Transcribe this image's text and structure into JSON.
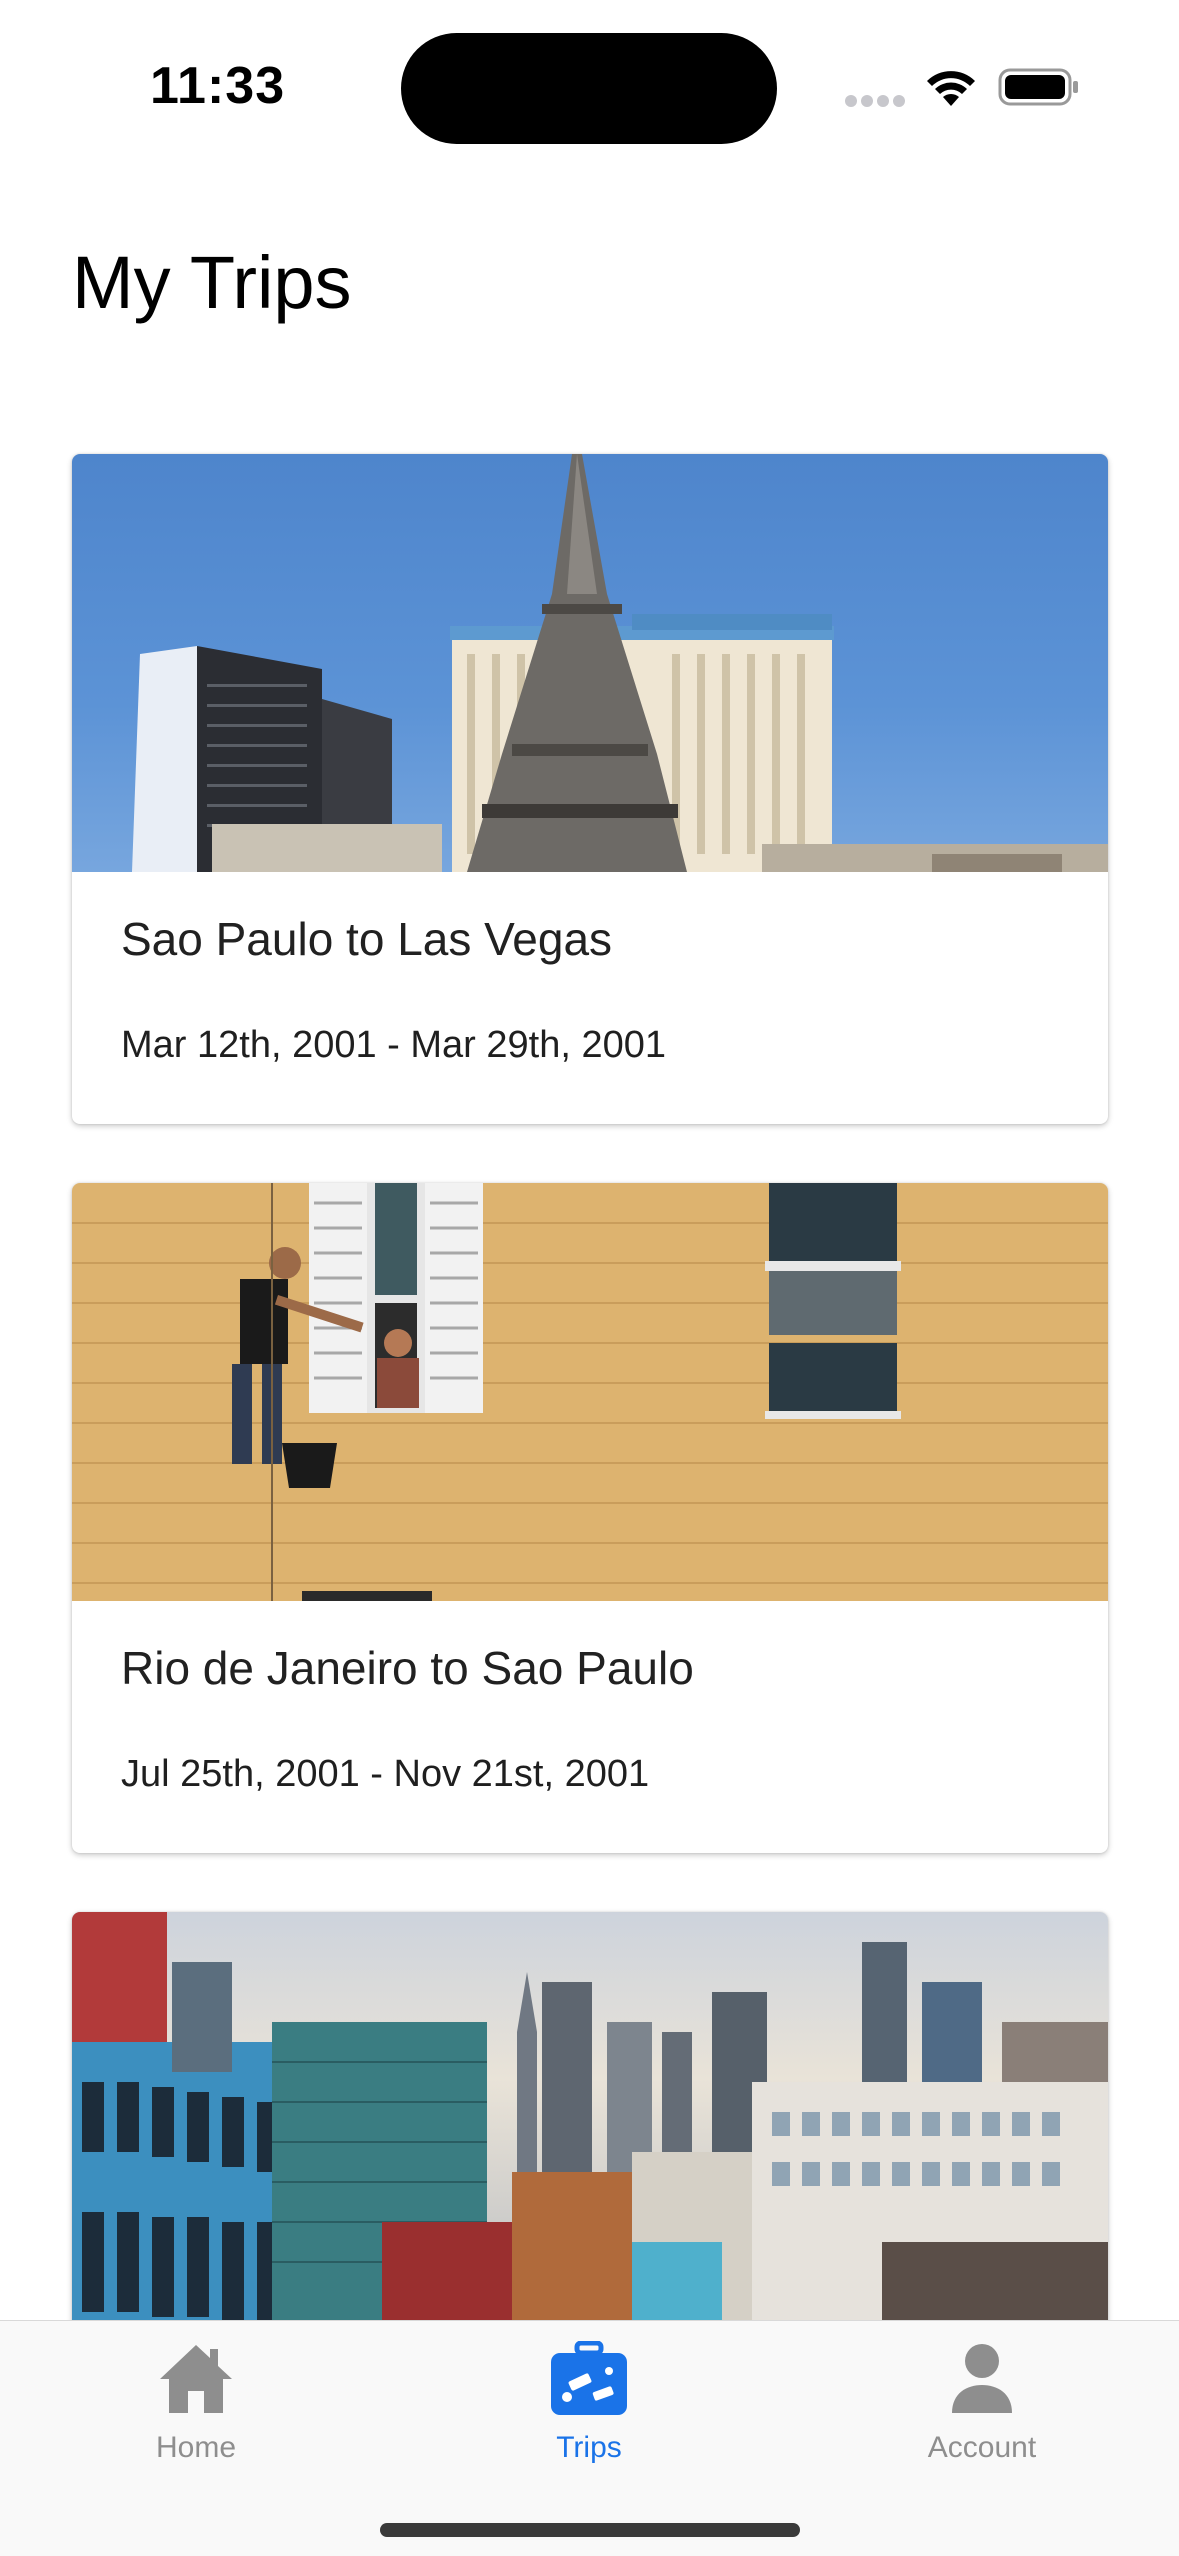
{
  "status_bar": {
    "time": "11:33"
  },
  "page": {
    "title": "My Trips"
  },
  "trips": [
    {
      "title": "Sao Paulo to Las Vegas",
      "dates": "Mar 12th, 2001 - Mar 29th, 2001",
      "image": "las-vegas-paris-hotel-photo"
    },
    {
      "title": "Rio de Janeiro to Sao Paulo",
      "dates": "Jul 25th, 2001 - Nov 21st, 2001",
      "image": "yellow-wall-window-climber-photo"
    },
    {
      "title": "",
      "dates": "",
      "image": "city-skyline-photo"
    }
  ],
  "tab_bar": {
    "items": [
      {
        "label": "Home",
        "icon": "home-icon",
        "active": false
      },
      {
        "label": "Trips",
        "icon": "suitcase-icon",
        "active": true
      },
      {
        "label": "Account",
        "icon": "person-icon",
        "active": false
      }
    ],
    "active_color": "#1a73e8",
    "inactive_color": "#8e8e8e"
  }
}
